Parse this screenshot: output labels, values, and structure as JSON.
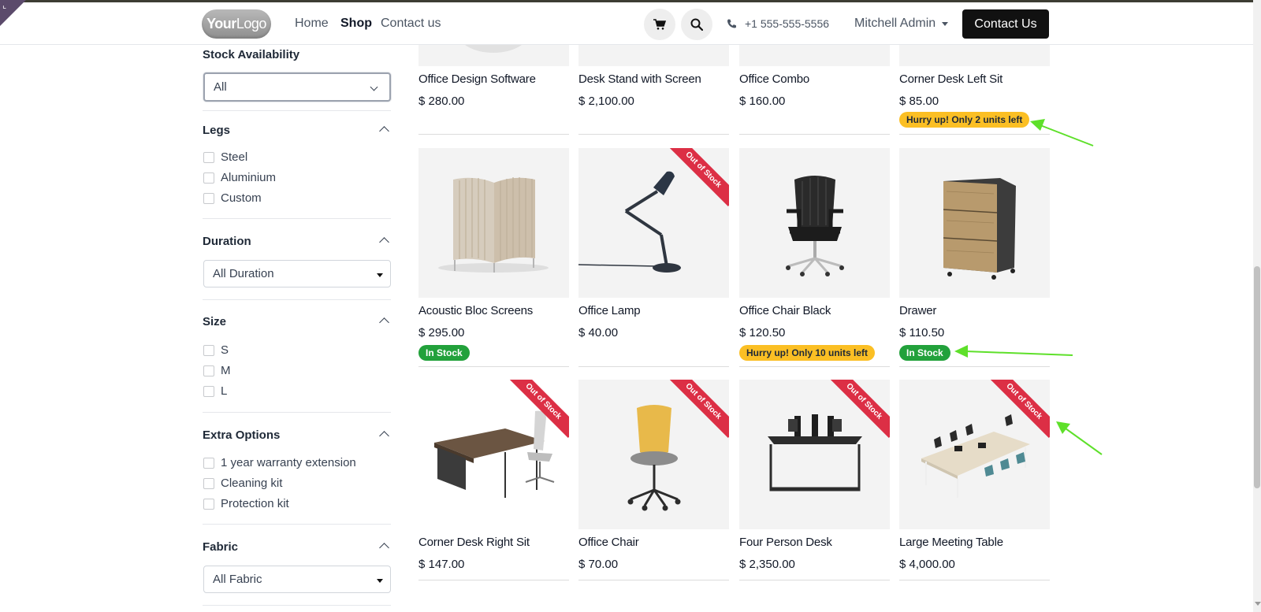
{
  "header": {
    "logo": {
      "bold": "Your",
      "light": "Logo"
    },
    "nav": [
      {
        "label": "Home"
      },
      {
        "label": "Shop"
      },
      {
        "label": "Contact us"
      }
    ],
    "phone": "+1 555-555-5556",
    "user": "Mitchell Admin",
    "cta": "Contact Us"
  },
  "filters": {
    "stock": {
      "title": "Stock Availability",
      "value": "All"
    },
    "legs": {
      "title": "Legs",
      "options": [
        "Steel",
        "Aluminium",
        "Custom"
      ]
    },
    "duration": {
      "title": "Duration",
      "value": "All Duration"
    },
    "size": {
      "title": "Size",
      "options": [
        "S",
        "M",
        "L"
      ]
    },
    "extra": {
      "title": "Extra Options",
      "options": [
        "1 year warranty extension",
        "Cleaning kit",
        "Protection kit"
      ]
    },
    "fabric": {
      "title": "Fabric",
      "value": "All Fabric"
    }
  },
  "products": [
    {
      "name": "Office Design Software",
      "price": "$ 280.00"
    },
    {
      "name": "Desk Stand with Screen",
      "price": "$ 2,100.00"
    },
    {
      "name": "Office Combo",
      "price": "$ 160.00"
    },
    {
      "name": "Corner Desk Left Sit",
      "price": "$ 85.00",
      "badge": "Hurry up! Only 2 units left"
    },
    {
      "name": "Acoustic Bloc Screens",
      "price": "$ 295.00",
      "badge": "In Stock"
    },
    {
      "name": "Office Lamp",
      "price": "$ 40.00",
      "ribbon": "Out of Stock"
    },
    {
      "name": "Office Chair Black",
      "price": "$ 120.50",
      "badge": "Hurry up! Only 10 units left"
    },
    {
      "name": "Drawer",
      "price": "$ 110.50",
      "badge": "In Stock"
    },
    {
      "name": "Corner Desk Right Sit",
      "price": "$ 147.00",
      "ribbon": "Out of Stock"
    },
    {
      "name": "Office Chair",
      "price": "$ 70.00",
      "ribbon": "Out of Stock"
    },
    {
      "name": "Four Person Desk",
      "price": "$ 2,350.00",
      "ribbon": "Out of Stock"
    },
    {
      "name": "Large Meeting Table",
      "price": "$ 4,000.00",
      "ribbon": "Out of Stock"
    }
  ],
  "colors": {
    "annotation_arrow": "#5ee02a",
    "hurry": "#fbbf24",
    "in_stock": "#22a13b",
    "out_of_stock": "#dc2f45"
  }
}
